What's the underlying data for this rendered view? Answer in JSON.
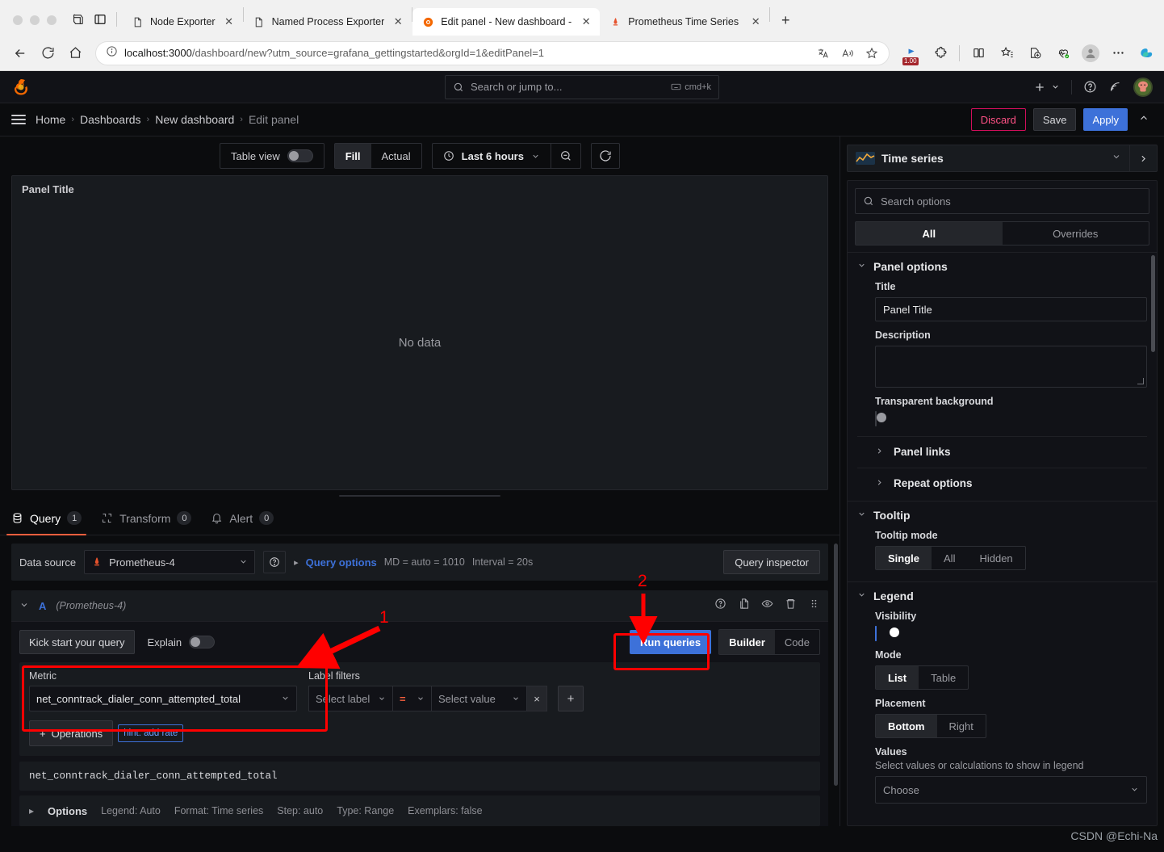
{
  "browser": {
    "tabs": [
      {
        "title": "Node Exporter",
        "favicon": "page-icon",
        "active": false
      },
      {
        "title": "Named Process Exporter",
        "favicon": "page-icon",
        "active": false
      },
      {
        "title": "Edit panel - New dashboard - D",
        "favicon": "grafana-icon",
        "active": true
      },
      {
        "title": "Prometheus Time Series Collec",
        "favicon": "prometheus-icon",
        "active": false
      }
    ],
    "new_tab_label": "+",
    "url_host": "localhost:3000",
    "url_path": "/dashboard/new?utm_source=grafana_gettingstarted&orgId=1&editPanel=1",
    "zoom_badge": "1.00"
  },
  "topnav": {
    "search_placeholder": "Search or jump to...",
    "search_shortcut": "cmd+k"
  },
  "breadcrumb": {
    "items": [
      "Home",
      "Dashboards",
      "New dashboard",
      "Edit panel"
    ],
    "separator": "›",
    "discard_label": "Discard",
    "save_label": "Save",
    "apply_label": "Apply"
  },
  "viz_toolbar": {
    "table_view_label": "Table view",
    "table_view_on": false,
    "fill_label": "Fill",
    "actual_label": "Actual",
    "fill_selected": true,
    "time_range": "Last 6 hours"
  },
  "panel": {
    "title": "Panel Title",
    "no_data": "No data"
  },
  "query_tabs": [
    {
      "label": "Query",
      "count": "1",
      "icon": "database-icon",
      "active": true
    },
    {
      "label": "Transform",
      "count": "0",
      "icon": "transform-icon",
      "active": false
    },
    {
      "label": "Alert",
      "count": "0",
      "icon": "bell-icon",
      "active": false
    }
  ],
  "datasource_row": {
    "label": "Data source",
    "value": "Prometheus-4",
    "query_options_label": "Query options",
    "md_text": "MD = auto = 1010",
    "interval_text": "Interval = 20s",
    "query_inspector_label": "Query inspector"
  },
  "query_row": {
    "ref_id": "A",
    "datasource_note": "(Prometheus-4)",
    "kick_start_label": "Kick start your query",
    "explain_label": "Explain",
    "explain_on": false,
    "run_queries_label": "Run queries",
    "builder_label": "Builder",
    "code_label": "Code",
    "builder_selected": true,
    "metric_label": "Metric",
    "metric_value": "net_conntrack_dialer_conn_attempted_total",
    "label_filters_label": "Label filters",
    "select_label_placeholder": "Select label",
    "operator": "=",
    "select_value_placeholder": "Select value",
    "remove_filter_label": "×",
    "add_filter_label": "+",
    "operations_label": "Operations",
    "operations_plus": "+",
    "hint_label": "hint: add rate",
    "raw_query": "net_conntrack_dialer_conn_attempted_total",
    "options_label": "Options",
    "options_meta": [
      "Legend: Auto",
      "Format: Time series",
      "Step: auto",
      "Type: Range",
      "Exemplars: false"
    ]
  },
  "options_pane": {
    "viz_name": "Time series",
    "search_placeholder": "Search options",
    "tab_all": "All",
    "tab_overrides": "Overrides",
    "all_selected": true,
    "sections": {
      "panel_options": {
        "title": "Panel options",
        "title_label": "Title",
        "title_value": "Panel Title",
        "description_label": "Description",
        "description_value": "",
        "transparent_label": "Transparent background",
        "transparent_on": false,
        "panel_links_label": "Panel links",
        "repeat_options_label": "Repeat options"
      },
      "tooltip": {
        "title": "Tooltip",
        "mode_label": "Tooltip mode",
        "mode_options": [
          "Single",
          "All",
          "Hidden"
        ],
        "mode_selected": "Single"
      },
      "legend": {
        "title": "Legend",
        "visibility_label": "Visibility",
        "visibility_on": true,
        "mode_label": "Mode",
        "mode_options": [
          "List",
          "Table"
        ],
        "mode_selected": "List",
        "placement_label": "Placement",
        "placement_options": [
          "Bottom",
          "Right"
        ],
        "placement_selected": "Bottom",
        "values_label": "Values",
        "values_sub": "Select values or calculations to show in legend",
        "values_placeholder": "Choose"
      }
    }
  },
  "annotations": [
    {
      "id": "1",
      "number": "1"
    },
    {
      "id": "2",
      "number": "2"
    }
  ],
  "watermark": "CSDN @Echi-Na",
  "colors": {
    "accent_blue": "#3d71d9",
    "accent_orange": "#f55f3e",
    "danger_pink": "#d10e5c",
    "annotation_red": "#ff0000",
    "panel_bg": "#181b1f",
    "app_bg": "#0b0c0e"
  }
}
